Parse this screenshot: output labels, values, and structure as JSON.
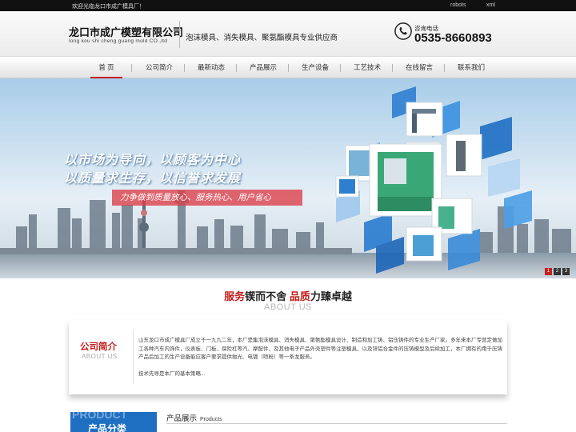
{
  "topbar": {
    "welcome": "欢迎光临龙口市成广模具厂！",
    "links": [
      "robots",
      "xml"
    ]
  },
  "header": {
    "company_cn": "龙口市成广模塑有限公司",
    "company_en": "long kou shi cheng guang mold CO.,ltd",
    "slogan": "泡沫模具、消失模具、聚氨酯模具专业供应商",
    "phone_label": "咨询电话",
    "phone": "0535-8660893"
  },
  "nav": {
    "items": [
      "首 页",
      "公司简介",
      "最新动态",
      "产品展示",
      "生产设备",
      "工艺技术",
      "在线留言",
      "联系我们"
    ],
    "active": 0
  },
  "banner": {
    "line1": "以市场为导向，以顾客为中心",
    "line2": "以质量求生存，以信誉求发展",
    "tagline": "力争做到质量放心、服务热心、用户省心",
    "pages": [
      "1",
      "2",
      "3"
    ],
    "active_page": 0
  },
  "motto": {
    "part1_red": "服务",
    "part1": "锲而不舍",
    "part2_red": "品质",
    "part2": "力臻卓越",
    "en": "ABOUT US"
  },
  "about": {
    "title": "公司简介",
    "subtitle": "ABOUT US",
    "text": "山东龙口市成广模具厂成立于一九九二年，本厂是集泡沫模具、消失模具、聚氨酯模具设计、制造和加工铸、铝压铸件的专业生产厂家。多年来本厂专营定做加工各种汽车内饰件，仪表板、门板、保险杠等汽、摩配件，及其他电子产品外壳塑件等注塑模具，以及锌铝合金件的压铸模型及后续加工，本厂拥有的用于压铸产品后加工的生产设备能应客户要求提供抛光、电镀（喷粉）等一条龙服务。",
    "more": "技术先导是本厂的基本策略..."
  },
  "products": {
    "box_en": "PRODUCT",
    "box_cn": "产品分类",
    "title": "产品展示",
    "title_en": "Products"
  },
  "colors": {
    "accent_red": "#c51c1c",
    "accent_blue": "#1e6fc2"
  }
}
